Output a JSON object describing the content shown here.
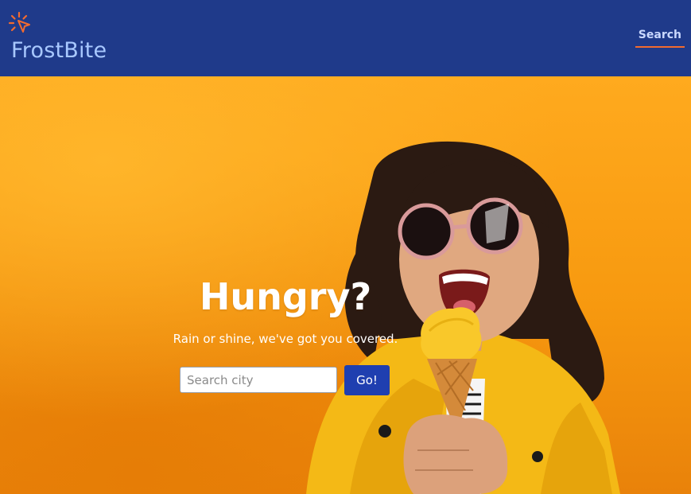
{
  "header": {
    "brand": "FrostBite",
    "logo_icon": "cursor-click-icon",
    "nav": {
      "search_label": "Search"
    },
    "colors": {
      "background": "#1f3a8a",
      "brand_text": "#a8c8ff",
      "nav_underline": "#f26b2f"
    }
  },
  "hero": {
    "title": "Hungry?",
    "subtitle": "Rain or shine, we've got you covered.",
    "search": {
      "placeholder": "Search city",
      "value": ""
    },
    "go_label": "Go!",
    "image": "girl-with-ice-cream-cone",
    "colors": {
      "background": "#ffaa1e",
      "button": "#1f3fb0"
    }
  }
}
